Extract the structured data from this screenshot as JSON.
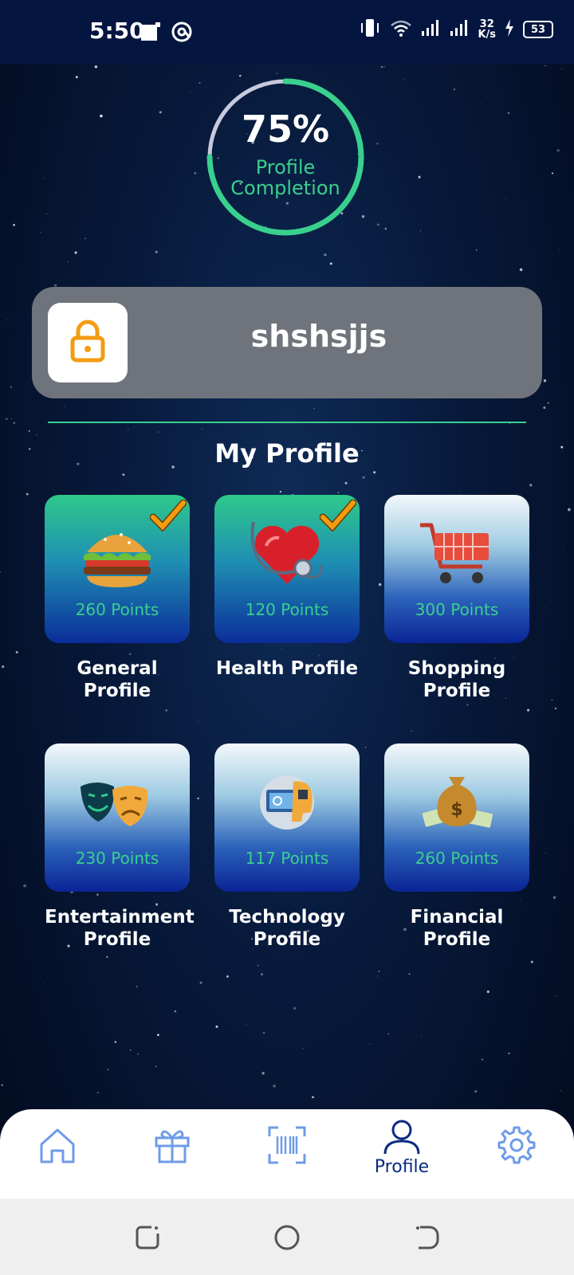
{
  "status_bar": {
    "time": "5:50",
    "network_speed_value": "32",
    "network_speed_unit": "K/s",
    "battery": "53"
  },
  "progress": {
    "percent_text": "75%",
    "value": 0.75,
    "label_line1": "Profile",
    "label_line2": "Completion",
    "colors": {
      "progress": "#39d08e",
      "track": "#c7c9dd"
    }
  },
  "user": {
    "name": "shshsjjs",
    "icon": "lock-icon"
  },
  "section_title": "My Profile",
  "profiles": [
    {
      "label_line1": "General",
      "label_line2": "Profile",
      "points": "260 Points",
      "completed": true,
      "icon": "burger-icon"
    },
    {
      "label_line1": "Health Profile",
      "label_line2": "",
      "points": "120 Points",
      "completed": true,
      "icon": "heart-stethoscope-icon"
    },
    {
      "label_line1": "Shopping",
      "label_line2": "Profile",
      "points": "300 Points",
      "completed": false,
      "icon": "shopping-cart-icon"
    },
    {
      "label_line1": "Entertainment",
      "label_line2": "Profile",
      "points": "230 Points",
      "completed": false,
      "icon": "theater-masks-icon"
    },
    {
      "label_line1": "Technology",
      "label_line2": "Profile",
      "points": "117 Points",
      "completed": false,
      "icon": "tech-head-icon"
    },
    {
      "label_line1": "Financial",
      "label_line2": "Profile",
      "points": "260 Points",
      "completed": false,
      "icon": "money-bag-icon"
    }
  ],
  "bottom_nav": {
    "items": [
      {
        "icon": "home-icon",
        "label": ""
      },
      {
        "icon": "gift-icon",
        "label": ""
      },
      {
        "icon": "barcode-scan-icon",
        "label": ""
      },
      {
        "icon": "profile-icon",
        "label": "Profile",
        "active": true
      },
      {
        "icon": "settings-icon",
        "label": ""
      }
    ],
    "colors": {
      "active": "#0a2b80",
      "inactive": "#6f9be8"
    }
  }
}
